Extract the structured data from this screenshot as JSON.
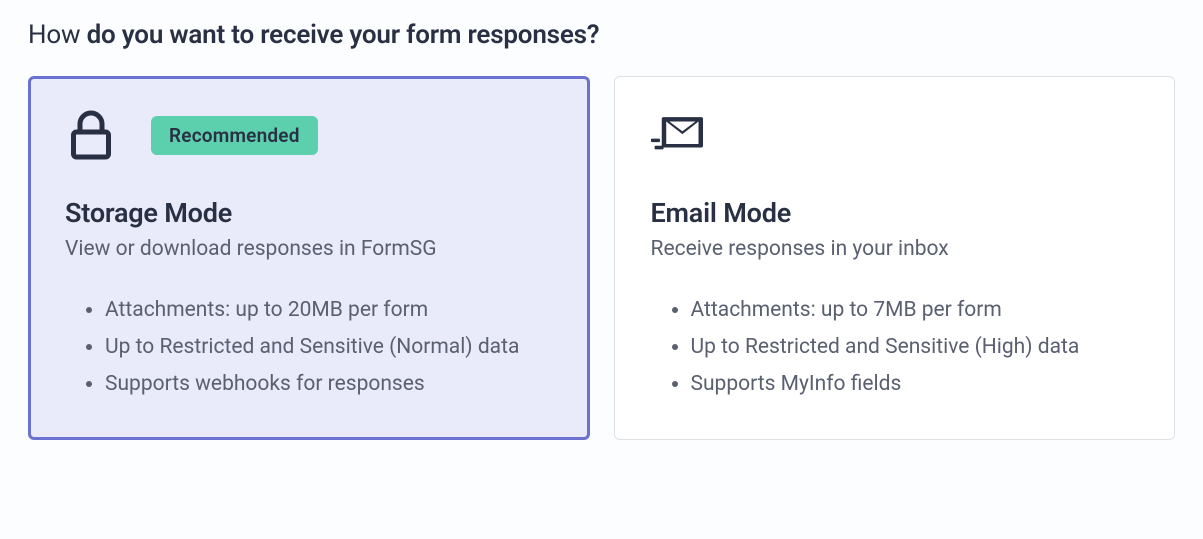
{
  "question": {
    "prefix": "How ",
    "bold": "do you want to receive your form responses?"
  },
  "options": {
    "storage": {
      "badge": "Recommended",
      "title": "Storage Mode",
      "subtitle": "View or download responses in FormSG",
      "bullets": [
        "Attachments: up to 20MB per form",
        "Up to Restricted and Sensitive (Normal) data",
        "Supports webhooks for responses"
      ]
    },
    "email": {
      "title": "Email Mode",
      "subtitle": "Receive responses in your inbox",
      "bullets": [
        "Attachments: up to 7MB per form",
        "Up to Restricted and Sensitive (High) data",
        "Supports MyInfo fields"
      ]
    }
  }
}
